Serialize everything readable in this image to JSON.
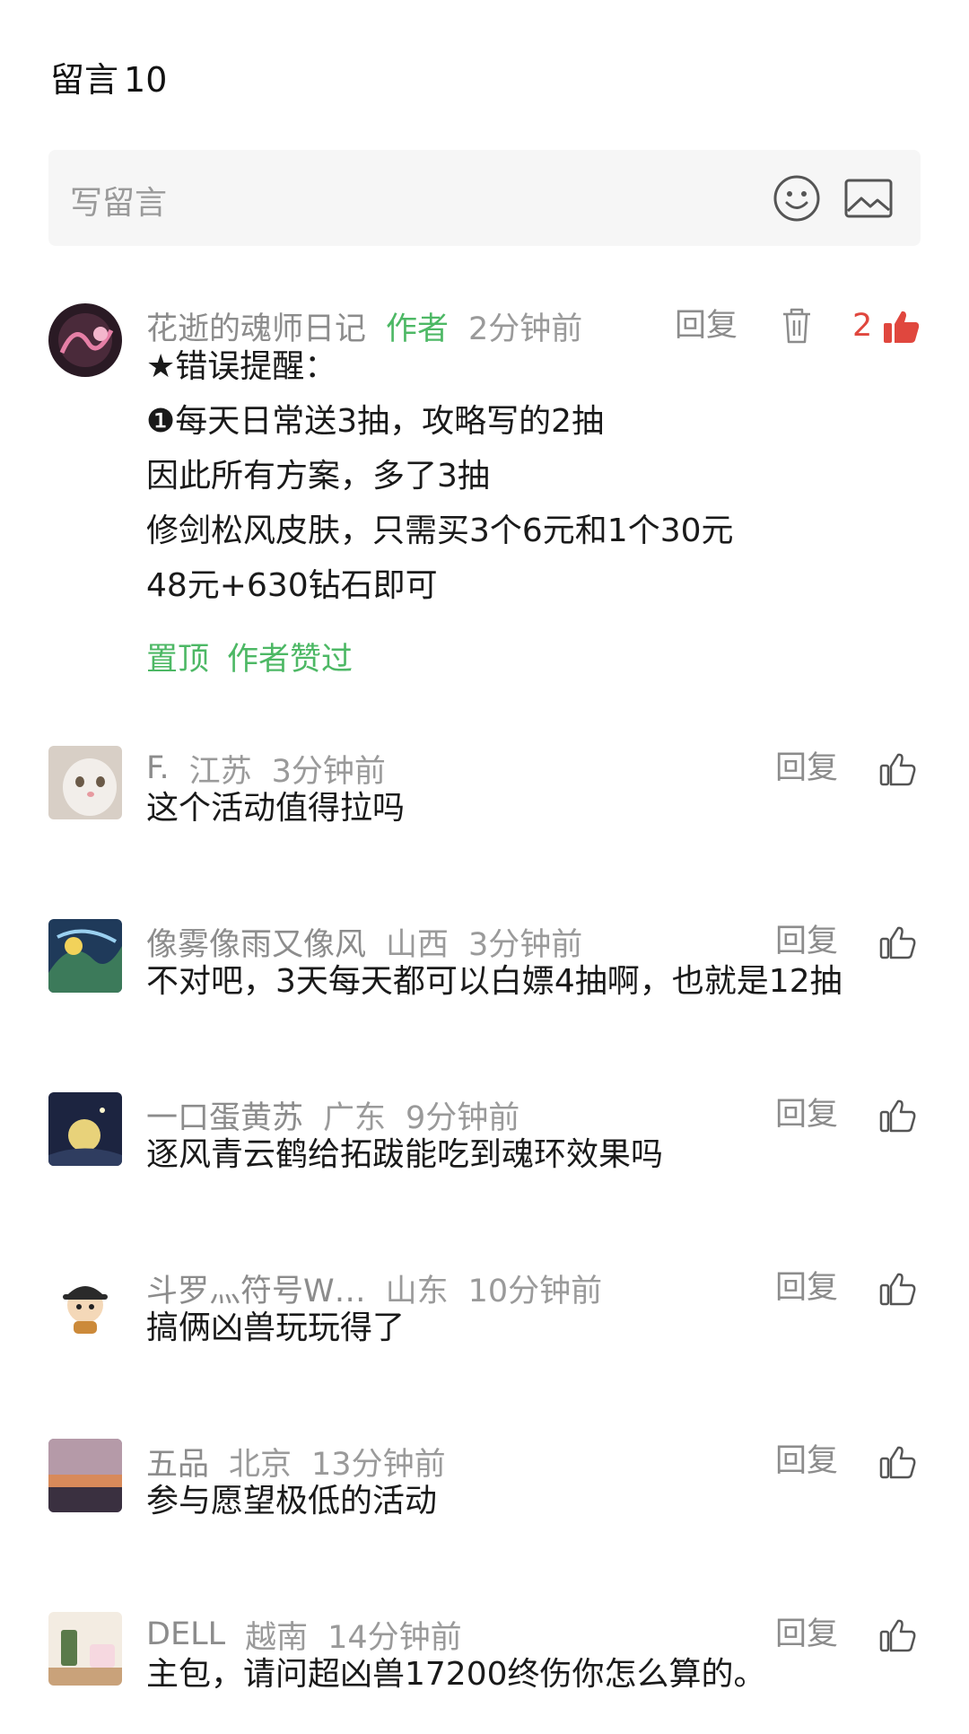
{
  "header": {
    "title": "留言",
    "count": "10"
  },
  "composer": {
    "placeholder": "写留言",
    "emoji_icon": "emoji-icon",
    "image_icon": "image-icon"
  },
  "colors": {
    "green": "#4db865",
    "red": "#e0473e",
    "gray": "#9a9a9a",
    "input_bg": "#f6f6f6"
  },
  "pinned": {
    "name": "花逝的魂师日记",
    "author_tag": "作者",
    "time": "2分钟前",
    "reply": "回复",
    "likes": "2",
    "lines": [
      "★错误提醒：",
      "❶每天日常送3抽，攻略写的2抽",
      "因此所有方案，多了3抽",
      "修剑松风皮肤，只需买3个6元和1个30元",
      "48元+630钻石即可"
    ],
    "tags": [
      "置顶",
      "作者赞过"
    ]
  },
  "comments": [
    {
      "name": "F.",
      "location": "江苏",
      "time": "3分钟前",
      "reply": "回复",
      "text": "这个活动值得拉吗"
    },
    {
      "name": "像雾像雨又像风",
      "location": "山西",
      "time": "3分钟前",
      "reply": "回复",
      "text": "不对吧，3天每天都可以白嫖4抽啊，也就是12抽"
    },
    {
      "name": "一口蛋黄苏",
      "location": "广东",
      "time": "9分钟前",
      "reply": "回复",
      "text": "逐风青云鹤给拓跋能吃到魂环效果吗"
    },
    {
      "name": "斗罗灬符号W…",
      "location": "山东",
      "time": "10分钟前",
      "reply": "回复",
      "text": "搞俩凶兽玩玩得了"
    },
    {
      "name": "五品",
      "location": "北京",
      "time": "13分钟前",
      "reply": "回复",
      "text": "参与愿望极低的活动"
    },
    {
      "name": "DELL",
      "location": "越南",
      "time": "14分钟前",
      "reply": "回复",
      "text": "主包，请问超凶兽17200终伤你怎么算的。"
    }
  ]
}
